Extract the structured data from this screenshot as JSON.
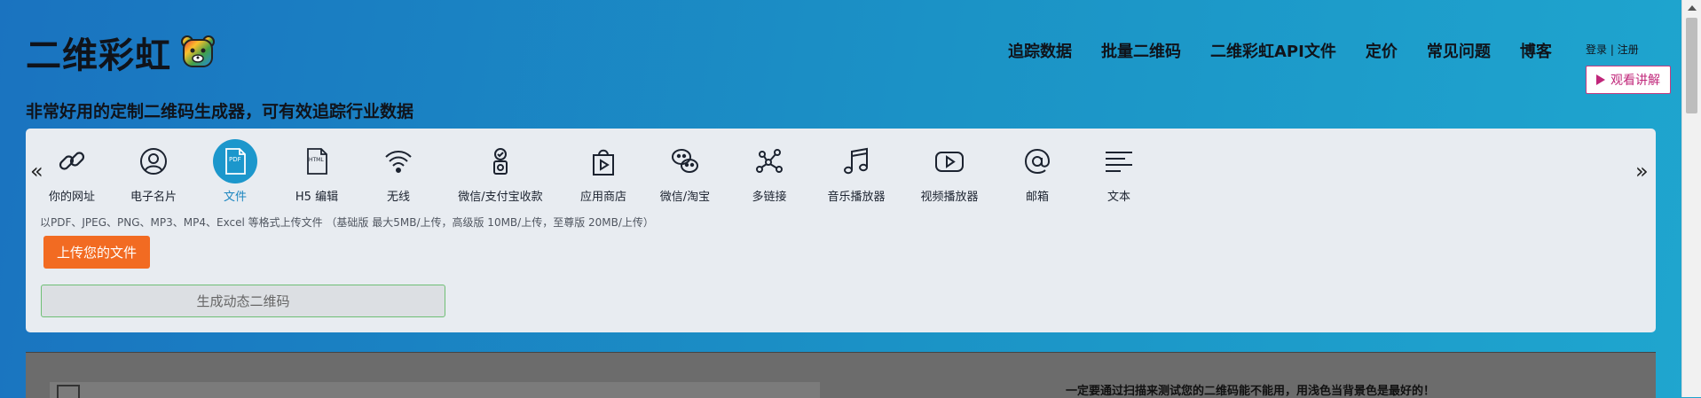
{
  "brand": {
    "name": "二维彩虹"
  },
  "tagline": "非常好用的定制二维码生成器，可有效追踪行业数据",
  "nav": [
    "追踪数据",
    "批量二维码",
    "二维彩虹API文件",
    "定价",
    "常见问题",
    "博客"
  ],
  "auth": {
    "login": "登录",
    "sep": " | ",
    "register": "注册"
  },
  "watch_button": "观看讲解",
  "tabs": [
    {
      "label": "你的网址",
      "icon": "link-icon"
    },
    {
      "label": "电子名片",
      "icon": "user-icon"
    },
    {
      "label": "文件",
      "icon": "pdf-file-icon",
      "active": true,
      "icon_text": "PDF"
    },
    {
      "label": "H5 编辑",
      "icon": "html-icon",
      "icon_text": "HTML"
    },
    {
      "label": "无线",
      "icon": "wifi-icon"
    },
    {
      "label": "微信/支付宝收款",
      "icon": "payment-icon"
    },
    {
      "label": "应用商店",
      "icon": "app-store-icon"
    },
    {
      "label": "微信/淘宝",
      "icon": "wechat-icon"
    },
    {
      "label": "多链接",
      "icon": "multi-link-icon"
    },
    {
      "label": "音乐播放器",
      "icon": "music-icon"
    },
    {
      "label": "视频播放器",
      "icon": "video-icon"
    },
    {
      "label": "邮箱",
      "icon": "email-icon"
    },
    {
      "label": "文本",
      "icon": "text-icon"
    }
  ],
  "upload_hint": "以PDF、JPEG、PNG、MP3、MP4、Excel 等格式上传文件 （基础版 最大5MB/上传，高级版 10MB/上传，至尊版 20MB/上传）",
  "upload_button": "上传您的文件",
  "generate_button": "生成动态二维码",
  "lower_tip": "一定要通过扫描来测试您的二维码能不能用，用浅色当背景色是最好的！",
  "colors": {
    "accent_orange": "#f26b22",
    "active_blue": "#1c97cc",
    "watch_pink": "#c0267a"
  }
}
